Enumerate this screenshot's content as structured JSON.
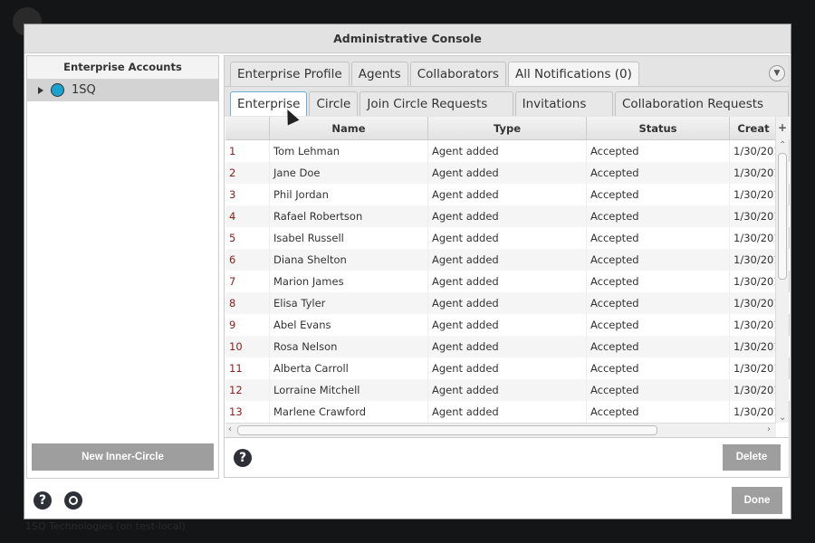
{
  "background": {
    "logo": "KoreFile",
    "status": "1SQ Technologies (on test-local)"
  },
  "dialog": {
    "title": "Administrative Console"
  },
  "left": {
    "header": "Enterprise Accounts",
    "tree": [
      {
        "label": "1SQ",
        "icon": "enterprise-icon"
      }
    ],
    "new_button": "New Inner-Circle"
  },
  "tabs": [
    "Enterprise Profile",
    "Agents",
    "Collaborators",
    "All Notifications (0)"
  ],
  "active_tab": "All Notifications (0)",
  "subtabs": [
    "Enterprise",
    "Circle",
    "Join Circle Requests (0)",
    "Invitations (0)",
    "Collaboration Requests (0)"
  ],
  "active_subtab": "Enterprise",
  "table": {
    "columns": [
      "",
      "Name",
      "Type",
      "Status",
      "Creat"
    ],
    "rows": [
      [
        "1",
        "Tom Lehman",
        "Agent added",
        "Accepted",
        "1/30/201"
      ],
      [
        "2",
        "Jane Doe",
        "Agent added",
        "Accepted",
        "1/30/201"
      ],
      [
        "3",
        "Phil Jordan",
        "Agent added",
        "Accepted",
        "1/30/201"
      ],
      [
        "4",
        "Rafael Robertson",
        "Agent added",
        "Accepted",
        "1/30/201"
      ],
      [
        "5",
        "Isabel Russell",
        "Agent added",
        "Accepted",
        "1/30/201"
      ],
      [
        "6",
        "Diana Shelton",
        "Agent added",
        "Accepted",
        "1/30/201"
      ],
      [
        "7",
        "Marion James",
        "Agent added",
        "Accepted",
        "1/30/201"
      ],
      [
        "8",
        "Elisa Tyler",
        "Agent added",
        "Accepted",
        "1/30/201"
      ],
      [
        "9",
        "Abel Evans",
        "Agent added",
        "Accepted",
        "1/30/201"
      ],
      [
        "10",
        "Rosa Nelson",
        "Agent added",
        "Accepted",
        "1/30/201"
      ],
      [
        "11",
        "Alberta Carroll",
        "Agent added",
        "Accepted",
        "1/30/201"
      ],
      [
        "12",
        "Lorraine Mitchell",
        "Agent added",
        "Accepted",
        "1/30/201"
      ],
      [
        "13",
        "Marlene Crawford",
        "Agent added",
        "Accepted",
        "1/30/201"
      ]
    ]
  },
  "right_footer": {
    "help": "?",
    "delete": "Delete"
  },
  "footer": {
    "help": "?",
    "done": "Done"
  }
}
